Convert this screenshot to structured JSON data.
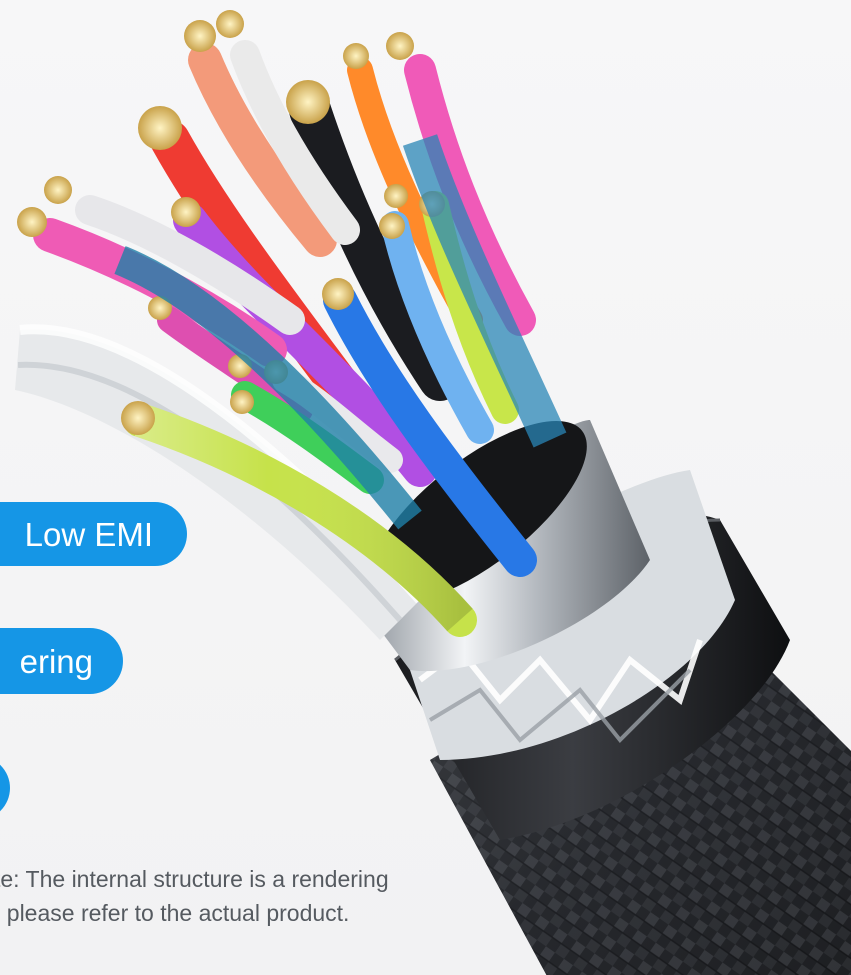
{
  "badges": [
    {
      "label": "Low EMI"
    },
    {
      "label": "ering"
    },
    {
      "label": ""
    }
  ],
  "note": {
    "line1": "te: The internal structure is a rendering",
    "line2": ", please refer to the actual product."
  },
  "colors": {
    "badge": "#1596e6",
    "note_text": "#555a60",
    "background": "#f5f5f6",
    "braid": "#2a2c30",
    "shield_silver": "#c9cdd2"
  },
  "image": {
    "subject": "cable-cross-section"
  }
}
